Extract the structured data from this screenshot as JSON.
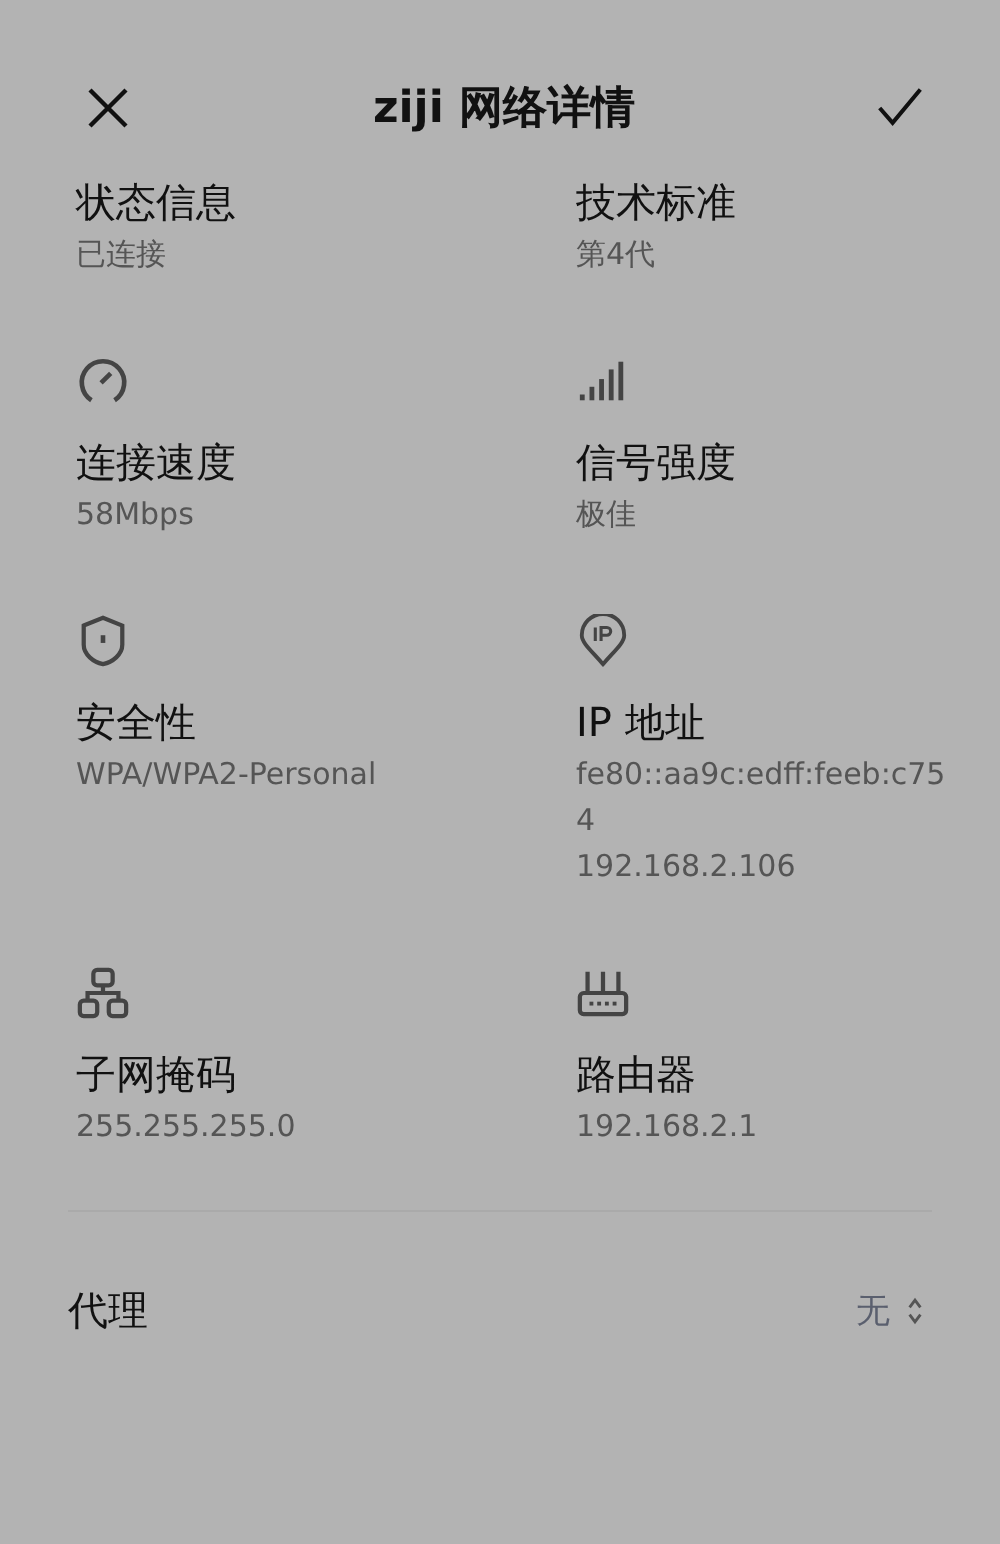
{
  "header": {
    "title": "ziji 网络详情"
  },
  "items": [
    {
      "label": "状态信息",
      "values": [
        "已连接"
      ]
    },
    {
      "label": "技术标准",
      "values": [
        "第4代"
      ]
    },
    {
      "label": "连接速度",
      "values": [
        "58Mbps"
      ]
    },
    {
      "label": "信号强度",
      "values": [
        "极佳"
      ]
    },
    {
      "label": "安全性",
      "values": [
        "WPA/WPA2-Personal"
      ]
    },
    {
      "label": "IP 地址",
      "values": [
        "fe80::aa9c:edff:feeb:c75",
        "4",
        "192.168.2.106"
      ]
    },
    {
      "label": "子网掩码",
      "values": [
        "255.255.255.0"
      ]
    },
    {
      "label": "路由器",
      "values": [
        "192.168.2.1"
      ]
    }
  ],
  "proxy": {
    "label": "代理",
    "value": "无"
  }
}
